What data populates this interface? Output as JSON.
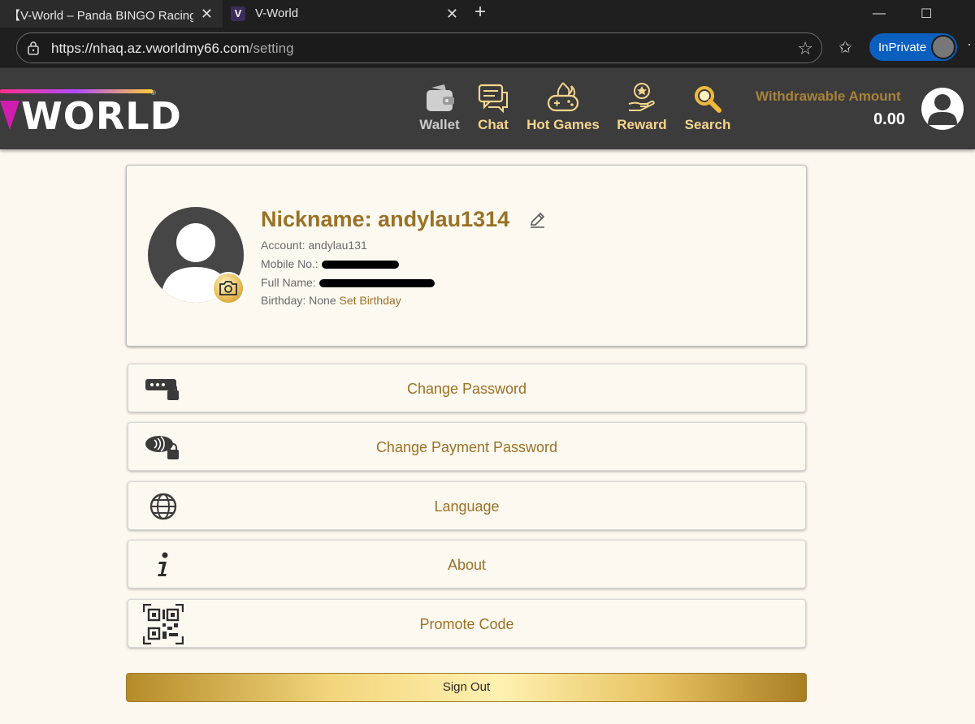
{
  "browser": {
    "tabs": [
      {
        "title": "【V-World – Panda BINGO Racing"
      },
      {
        "title": "V-World",
        "favicon": "V"
      }
    ],
    "address": {
      "host": "https://nhaq.az.vworldmy66.com",
      "path": "/setting"
    },
    "inprivate_label": "InPrivate"
  },
  "header": {
    "logo_text": "WORLD",
    "nav": [
      {
        "label": "Wallet",
        "icon": "wallet-icon"
      },
      {
        "label": "Chat",
        "icon": "chat-icon"
      },
      {
        "label": "Hot Games",
        "icon": "hot-games-icon"
      },
      {
        "label": "Reward",
        "icon": "reward-icon"
      },
      {
        "label": "Search",
        "icon": "search-icon"
      }
    ],
    "withdraw_label": "Withdrawable Amount",
    "withdraw_amount": "0.00"
  },
  "profile": {
    "nickname": "Nickname: andylau1314",
    "account": "Account: andylau131",
    "mobile_label": "Mobile No.:",
    "fullname_label": "Full Name:",
    "birthday_label": "Birthday: None",
    "set_birthday": "Set Birthday"
  },
  "settings": [
    {
      "label": "Change Password",
      "icon": "password-lock-icon"
    },
    {
      "label": "Change Payment Password",
      "icon": "payment-lock-icon"
    },
    {
      "label": "Language",
      "icon": "globe-icon"
    },
    {
      "label": "About",
      "icon": "info-icon"
    },
    {
      "label": "Promote Code",
      "icon": "qr-code-icon"
    }
  ],
  "signout_label": "Sign Out",
  "colors": {
    "gold": "#9a7126",
    "header_bg": "#3c3c3c",
    "page_bg": "#fcf8ef"
  }
}
